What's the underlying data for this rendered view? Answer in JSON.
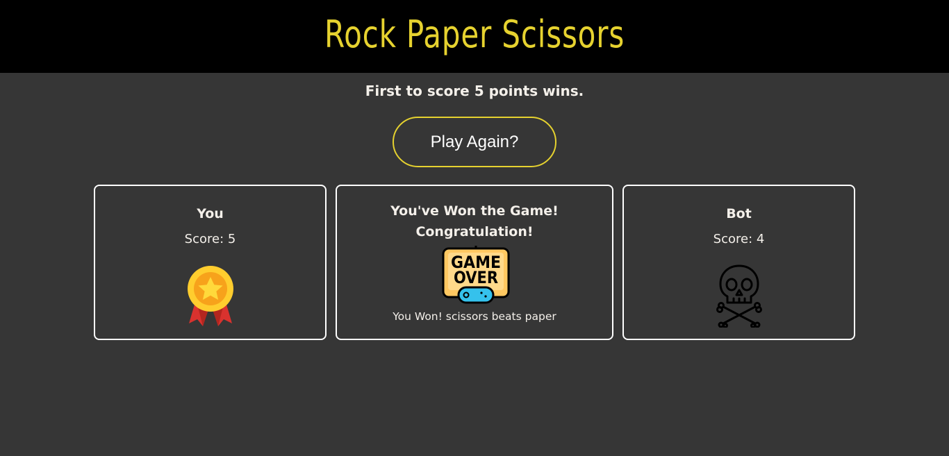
{
  "header": {
    "title": "Rock Paper Scissors"
  },
  "rules": {
    "text": "First to score 5 points wins."
  },
  "controls": {
    "play_again_label": "Play Again?"
  },
  "player": {
    "name": "You",
    "score_text": "Score: 5",
    "icon": "medal-icon"
  },
  "bot": {
    "name": "Bot",
    "score_text": "Score: 4",
    "icon": "skull-crossbones-icon"
  },
  "result": {
    "line1": "You've Won the Game!",
    "line2": "Congratulation!",
    "icon": "game-over-icon",
    "icon_text_top": "GAME",
    "icon_text_bottom": "OVER",
    "round_message": "You Won! scissors beats paper"
  },
  "colors": {
    "accent": "#e6d22f",
    "background": "#363636",
    "header": "#000000",
    "text": "#f4f0ea"
  }
}
